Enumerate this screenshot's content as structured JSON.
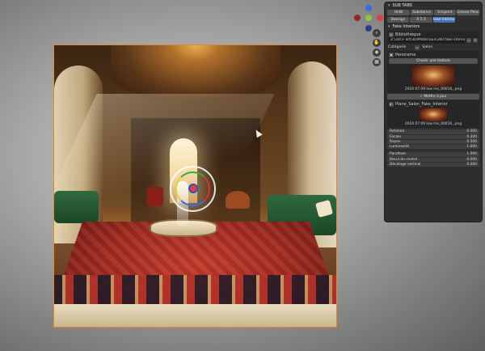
{
  "panel": {
    "title": "SUB TABS",
    "tab_row1": [
      "UnW",
      "Substance",
      "Unspent",
      "Grease Pencil"
    ],
    "tab_row2": [
      "Beesign",
      "X 5 3",
      "Fake Interiors"
    ],
    "section_title": "Fake Interiors",
    "bibliotheque": {
      "label": "Bibliothèque",
      "path": "Z:\\3D\\> art\\3D\\Matériaux\\360 fake interiors",
      "categorie_label": "Catégorie",
      "categorie_value": "Salon"
    },
    "panorama": {
      "label": "Panorama",
      "choose_button": "Choisir une texture",
      "thumb_caption": "2024 07 09 low res_00016_.png",
      "update_button": "Mettre à jour"
    },
    "object": {
      "name": "Plane_Salon_Fake_Interior",
      "thumb_caption": "2024 07 09 low res_00016_.png"
    },
    "params_group1": [
      {
        "label": "Rotation",
        "value": "0.000"
      },
      {
        "label": "Focale",
        "value": "0.300"
      },
      {
        "label": "Rayon",
        "value": "0.500"
      },
      {
        "label": "Luminosité",
        "value": "1.000"
      }
    ],
    "params_group2": [
      {
        "label": "Parallaxe",
        "value": "1.000"
      },
      {
        "label": "Recul du centre",
        "value": "0.000"
      },
      {
        "label": "Décalage vertical",
        "value": "0.000"
      }
    ]
  },
  "nav_gizmo": {
    "x_color": "#e04040",
    "y_color": "#8bc34a",
    "z_color": "#3a6ee0",
    "neg_color": "#8a2a2a"
  },
  "icons": [
    "zoom-icon",
    "hand-icon",
    "camera-icon",
    "grid-icon"
  ]
}
